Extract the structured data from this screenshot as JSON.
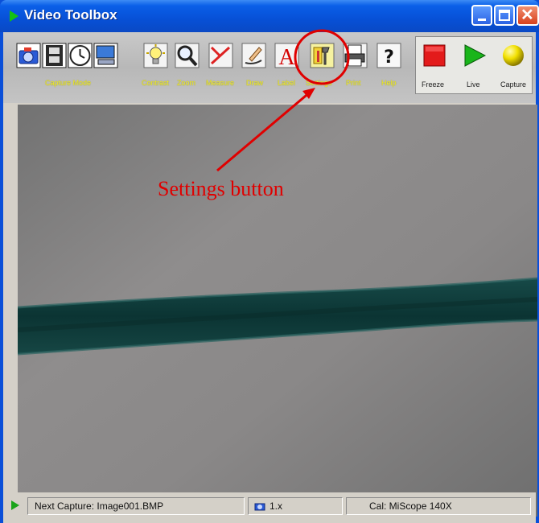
{
  "window": {
    "title": "Video Toolbox"
  },
  "toolbar": {
    "capture_mode_label": "Capture Mode",
    "tools": [
      {
        "name": "contrast",
        "label": "Contrast"
      },
      {
        "name": "zoom",
        "label": "Zoom"
      },
      {
        "name": "measure",
        "label": "Measure"
      },
      {
        "name": "draw",
        "label": "Draw"
      },
      {
        "name": "label",
        "label": "Label"
      },
      {
        "name": "settings",
        "label": "Settings"
      },
      {
        "name": "print",
        "label": "Print"
      },
      {
        "name": "help",
        "label": "Help"
      }
    ],
    "right": {
      "freeze_label": "Freeze",
      "live_label": "Live",
      "capture_label": "Capture"
    }
  },
  "annotation": {
    "text": "Settings button",
    "color": "#e00000"
  },
  "status": {
    "next_capture": "Next Capture: Image001.BMP",
    "zoom": "1.x",
    "calibration": "Cal: MiScope 140X"
  },
  "colors": {
    "titlebar": "#0750d6",
    "label_yellow": "#f3ee2a",
    "stripe": "#0b3a39"
  }
}
